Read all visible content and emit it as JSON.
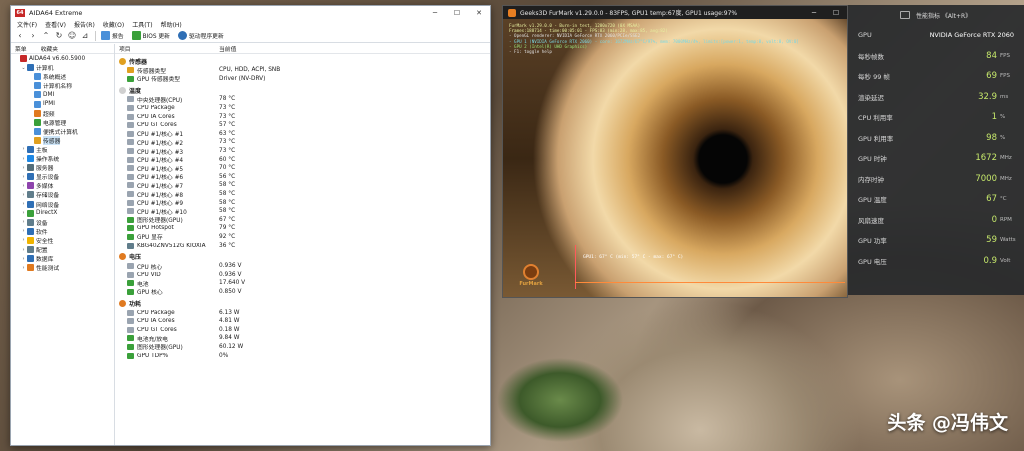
{
  "watermark": "头条 @冯伟文",
  "aida": {
    "title": "AIDA64 Extreme",
    "logo_text": "64",
    "menu": [
      "文件(F)",
      "查看(V)",
      "报告(R)",
      "收藏(O)",
      "工具(T)",
      "帮助(H)"
    ],
    "toolbar": {
      "report": "报告",
      "bios": "BIOS 更新",
      "driver": "驱动程序更新"
    },
    "left_headers": {
      "menu": "菜单",
      "fav": "收藏夹"
    },
    "tree": [
      {
        "label": "AIDA64 v6.60.5900",
        "indent": 0,
        "exp": "",
        "icon": "#c62828"
      },
      {
        "label": "计算机",
        "indent": 1,
        "exp": "⌄",
        "icon": "#2f6fb5"
      },
      {
        "label": "系统概述",
        "indent": 2,
        "exp": "",
        "icon": "#4a90d9"
      },
      {
        "label": "计算机名称",
        "indent": 2,
        "exp": "",
        "icon": "#4a90d9"
      },
      {
        "label": "DMI",
        "indent": 2,
        "exp": "",
        "icon": "#4a90d9"
      },
      {
        "label": "IPMI",
        "indent": 2,
        "exp": "",
        "icon": "#4a90d9"
      },
      {
        "label": "超频",
        "indent": 2,
        "exp": "",
        "icon": "#e07a20"
      },
      {
        "label": "电源管理",
        "indent": 2,
        "exp": "",
        "icon": "#3aa03a"
      },
      {
        "label": "便携式计算机",
        "indent": 2,
        "exp": "",
        "icon": "#4a90d9"
      },
      {
        "label": "传感器",
        "indent": 2,
        "exp": "",
        "icon": "#e0a020",
        "selected": true
      },
      {
        "label": "主板",
        "indent": 1,
        "exp": "›",
        "icon": "#2f6fb5"
      },
      {
        "label": "操作系统",
        "indent": 1,
        "exp": "›",
        "icon": "#1e88e5"
      },
      {
        "label": "服务器",
        "indent": 1,
        "exp": "›",
        "icon": "#546e7a"
      },
      {
        "label": "显示设备",
        "indent": 1,
        "exp": "›",
        "icon": "#2f6fb5"
      },
      {
        "label": "多媒体",
        "indent": 1,
        "exp": "›",
        "icon": "#8e44ad"
      },
      {
        "label": "存储设备",
        "indent": 1,
        "exp": "›",
        "icon": "#607d8b"
      },
      {
        "label": "网络设备",
        "indent": 1,
        "exp": "›",
        "icon": "#2f6fb5"
      },
      {
        "label": "DirectX",
        "indent": 1,
        "exp": "›",
        "icon": "#3aa03a"
      },
      {
        "label": "设备",
        "indent": 1,
        "exp": "›",
        "icon": "#607d8b"
      },
      {
        "label": "软件",
        "indent": 1,
        "exp": "›",
        "icon": "#2f6fb5"
      },
      {
        "label": "安全性",
        "indent": 1,
        "exp": "›",
        "icon": "#f0b400"
      },
      {
        "label": "配置",
        "indent": 1,
        "exp": "›",
        "icon": "#607d8b"
      },
      {
        "label": "数据库",
        "indent": 1,
        "exp": "›",
        "icon": "#2f6fb5"
      },
      {
        "label": "性能测试",
        "indent": 1,
        "exp": "›",
        "icon": "#e07a20"
      }
    ],
    "columns": {
      "item": "项目",
      "value": "当前值"
    },
    "sections": [
      {
        "title": "传感器",
        "icon": "#e0a020",
        "rows": [
          {
            "k": "传感器类型",
            "v": "CPU, HDD, ACPI, SNB",
            "icon": "#e0a020"
          },
          {
            "k": "GPU 传感器类型",
            "v": "Driver (NV-DRV)",
            "icon": "#3aa03a"
          }
        ]
      },
      {
        "title": "温度",
        "icon": "#d0d0d0",
        "rows": [
          {
            "k": "中央处理器(CPU)",
            "v": "78 °C",
            "icon": "#9aa4b0"
          },
          {
            "k": "CPU Package",
            "v": "73 °C",
            "icon": "#9aa4b0"
          },
          {
            "k": "CPU IA Cores",
            "v": "73 °C",
            "icon": "#9aa4b0"
          },
          {
            "k": "CPU GT Cores",
            "v": "57 °C",
            "icon": "#9aa4b0"
          },
          {
            "k": "CPU #1/核心 #1",
            "v": "63 °C",
            "icon": "#9aa4b0"
          },
          {
            "k": "CPU #1/核心 #2",
            "v": "73 °C",
            "icon": "#9aa4b0"
          },
          {
            "k": "CPU #1/核心 #3",
            "v": "73 °C",
            "icon": "#9aa4b0"
          },
          {
            "k": "CPU #1/核心 #4",
            "v": "60 °C",
            "icon": "#9aa4b0"
          },
          {
            "k": "CPU #1/核心 #5",
            "v": "70 °C",
            "icon": "#9aa4b0"
          },
          {
            "k": "CPU #1/核心 #6",
            "v": "56 °C",
            "icon": "#9aa4b0"
          },
          {
            "k": "CPU #1/核心 #7",
            "v": "58 °C",
            "icon": "#9aa4b0"
          },
          {
            "k": "CPU #1/核心 #8",
            "v": "58 °C",
            "icon": "#9aa4b0"
          },
          {
            "k": "CPU #1/核心 #9",
            "v": "58 °C",
            "icon": "#9aa4b0"
          },
          {
            "k": "CPU #1/核心 #10",
            "v": "58 °C",
            "icon": "#9aa4b0"
          },
          {
            "k": "图形处理器(GPU)",
            "v": "67 °C",
            "icon": "#3aa03a"
          },
          {
            "k": "GPU Hotspot",
            "v": "79 °C",
            "icon": "#3aa03a"
          },
          {
            "k": "GPU 显存",
            "v": "92 °C",
            "icon": "#3aa03a"
          },
          {
            "k": "KBG40ZNV512G KIOXIA",
            "v": "36 °C",
            "icon": "#607d8b"
          }
        ]
      },
      {
        "title": "电压",
        "icon": "#e07a20",
        "rows": [
          {
            "k": "CPU 核心",
            "v": "0.936 V",
            "icon": "#9aa4b0"
          },
          {
            "k": "CPU VID",
            "v": "0.936 V",
            "icon": "#9aa4b0"
          },
          {
            "k": "电池",
            "v": "17.640 V",
            "icon": "#3aa03a"
          },
          {
            "k": "GPU 核心",
            "v": "0.850 V",
            "icon": "#3aa03a"
          }
        ]
      },
      {
        "title": "功耗",
        "icon": "#e07a20",
        "rows": [
          {
            "k": "CPU Package",
            "v": "6.13 W",
            "icon": "#9aa4b0"
          },
          {
            "k": "CPU IA Cores",
            "v": "4.81 W",
            "icon": "#9aa4b0"
          },
          {
            "k": "CPU GT Cores",
            "v": "0.18 W",
            "icon": "#9aa4b0"
          },
          {
            "k": "电池充/放电",
            "v": "9.84 W",
            "icon": "#3aa03a"
          },
          {
            "k": "图形处理器(GPU)",
            "v": "60.12 W",
            "icon": "#3aa03a"
          },
          {
            "k": "GPU TDP%",
            "v": "0%",
            "icon": "#3aa03a"
          }
        ]
      }
    ]
  },
  "furmark": {
    "title": "Geeks3D FurMark v1.29.0.0 - 83FPS, GPU1 temp:67度, GPU1 usage:97%",
    "info": [
      {
        "text": "FurMark v1.29.0.0 - Burn-in test, 1280x720 (0X MSAA)",
        "cls": ""
      },
      {
        "text": "Frames:188714 - time:00:05:01 - FPS:83 (min:28, max:85, avg:82)",
        "cls": ""
      },
      {
        "text": "- OpenGL renderer: NVIDIA GeForce RTX 2060/PCIe/SSE2",
        "cls": "white"
      },
      {
        "text": "- GPU 1 (NVIDIA GeForce RTX 2060) - core: 1672MHz/67°C/97%, mem: 7000MHz/4%, limits:[power:1, temp:0, volt:0, OV:0]",
        "cls": "cyan"
      },
      {
        "text": "- GPU 2 (Intel(R) UHD Graphics)",
        "cls": "green"
      },
      {
        "text": "- F1: toggle help",
        "cls": "white"
      }
    ],
    "graph_label": "GPU1: 67° C (min: 57° C - max: 67° C)",
    "logo_text": "FurMark"
  },
  "perf": {
    "title": "性能指标 《Alt+R》",
    "rows": [
      {
        "label": "GPU",
        "value": "NVIDIA GeForce RTX 2060",
        "unit": "",
        "white": true
      },
      {
        "label": "每秒帧数",
        "value": "84",
        "unit": "FPS"
      },
      {
        "label": "每秒 99 帧",
        "value": "69",
        "unit": "FPS"
      },
      {
        "label": "渲染延迟",
        "value": "32.9",
        "unit": "ms"
      },
      {
        "label": "CPU 利用率",
        "value": "1",
        "unit": "%"
      },
      {
        "label": "GPU 利用率",
        "value": "98",
        "unit": "%"
      },
      {
        "label": "GPU 时钟",
        "value": "1672",
        "unit": "MHz"
      },
      {
        "label": "内存时钟",
        "value": "7000",
        "unit": "MHz"
      },
      {
        "label": "GPU 温度",
        "value": "67",
        "unit": "°C"
      },
      {
        "label": "风扇速度",
        "value": "0",
        "unit": "RPM"
      },
      {
        "label": "GPU 功率",
        "value": "59",
        "unit": "Watts"
      },
      {
        "label": "GPU 电压",
        "value": "0.9",
        "unit": "Volt"
      }
    ]
  }
}
